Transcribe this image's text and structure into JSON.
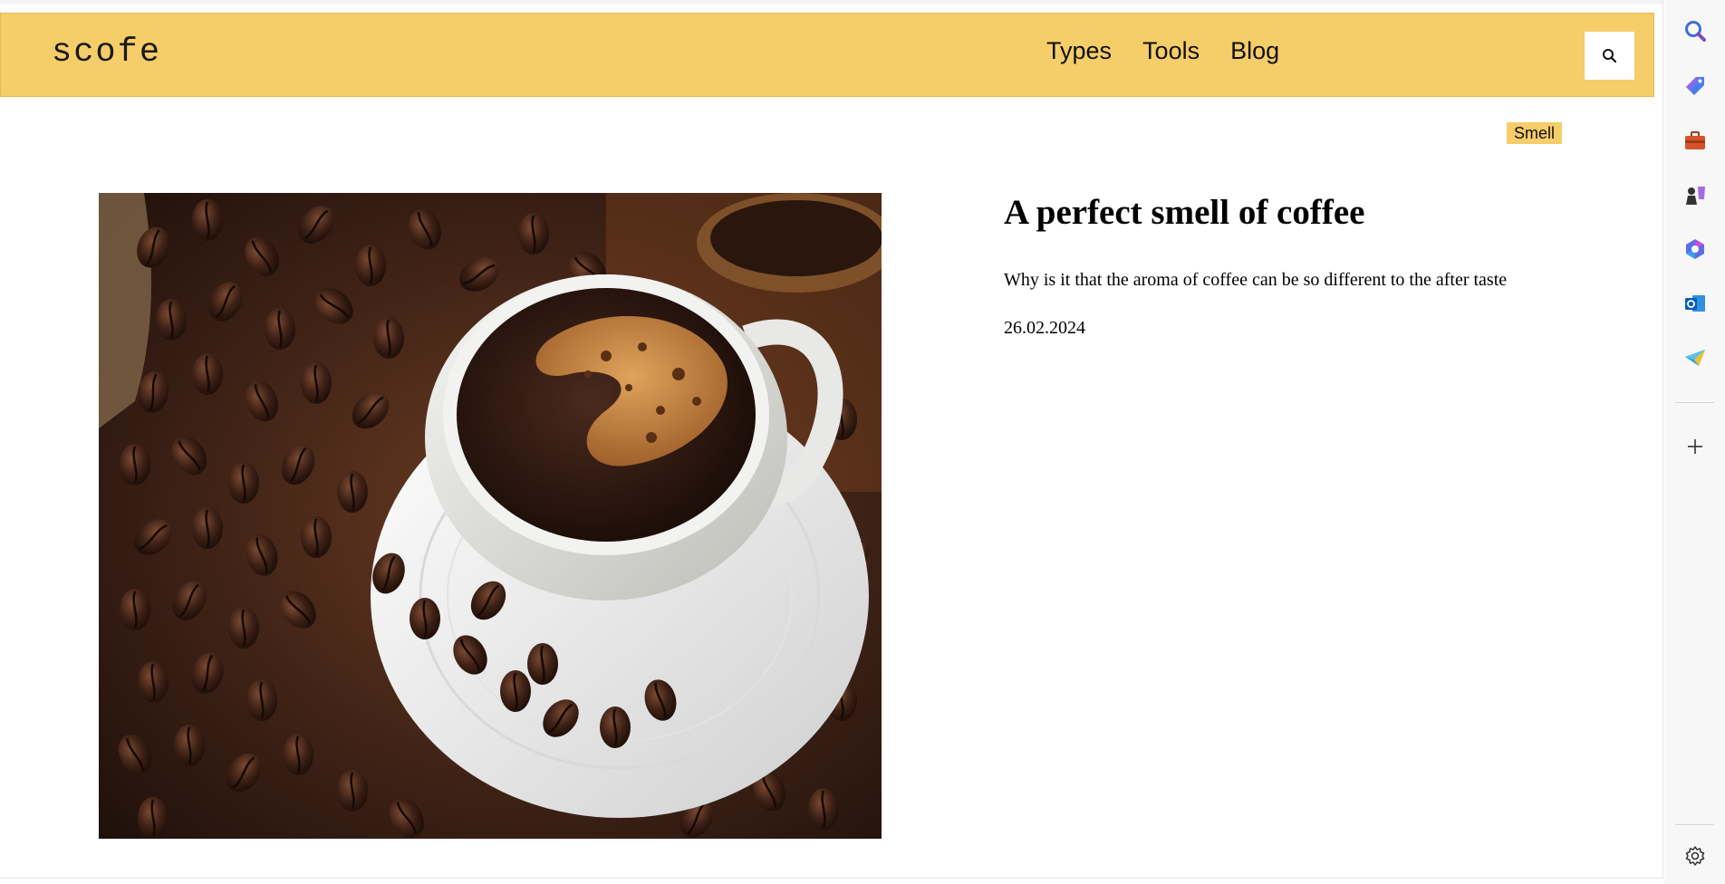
{
  "site": {
    "logo": "scofe",
    "nav": [
      "Types",
      "Tools",
      "Blog"
    ]
  },
  "article": {
    "tag": "Smell",
    "title": "A perfect smell of coffee",
    "description": "Why is it that the aroma of coffee can be so different to the after taste",
    "date": "26.02.2024",
    "image": "coffee-cup-beans"
  },
  "sidebar": {
    "icons": [
      "search-icon",
      "tag-icon",
      "toolbox-icon",
      "games-icon",
      "copilot-icon",
      "outlook-icon",
      "send-icon",
      "add-icon",
      "settings-icon"
    ]
  },
  "colors": {
    "header_bg": "#f5cd69",
    "page_bg": "#ffffff",
    "sidebar_bg": "#f7f7f7"
  }
}
